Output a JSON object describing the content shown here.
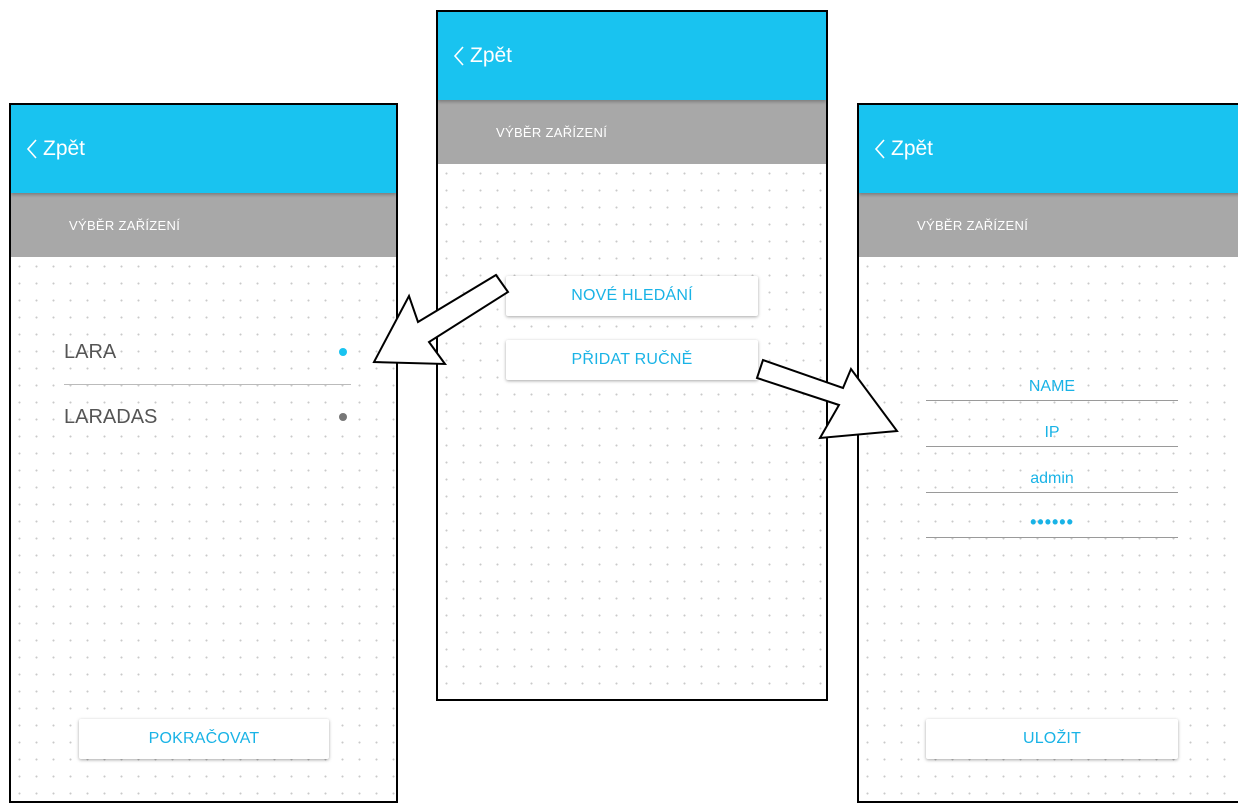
{
  "colors": {
    "accent": "#19c3f0",
    "text_accent": "#19b3e6",
    "subbar": "#a8a8a8",
    "dot_selected": "#19c3f0",
    "dot_default": "#777777"
  },
  "left_screen": {
    "back_label": "Zpět",
    "section_title": "VÝBĚR ZAŘÍZENÍ",
    "devices": [
      {
        "name": "LARA",
        "status": "selected"
      },
      {
        "name": "LARADAS",
        "status": "unselected"
      }
    ],
    "continue_label": "POKRAČOVAT"
  },
  "middle_screen": {
    "back_label": "Zpět",
    "section_title": "VÝBĚR ZAŘÍZENÍ",
    "new_search_label": "NOVÉ HLEDÁNÍ",
    "add_manually_label": "PŘIDAT RUČNĚ"
  },
  "right_screen": {
    "back_label": "Zpět",
    "section_title": "VÝBĚR ZAŘÍZENÍ",
    "fields": {
      "name": "NAME",
      "ip": "IP",
      "user": "admin",
      "password": "••••••"
    },
    "save_label": "ULOŽIT"
  },
  "icons": {
    "back": "chevron-left-icon",
    "flow_arrow": "arrow-icon"
  }
}
